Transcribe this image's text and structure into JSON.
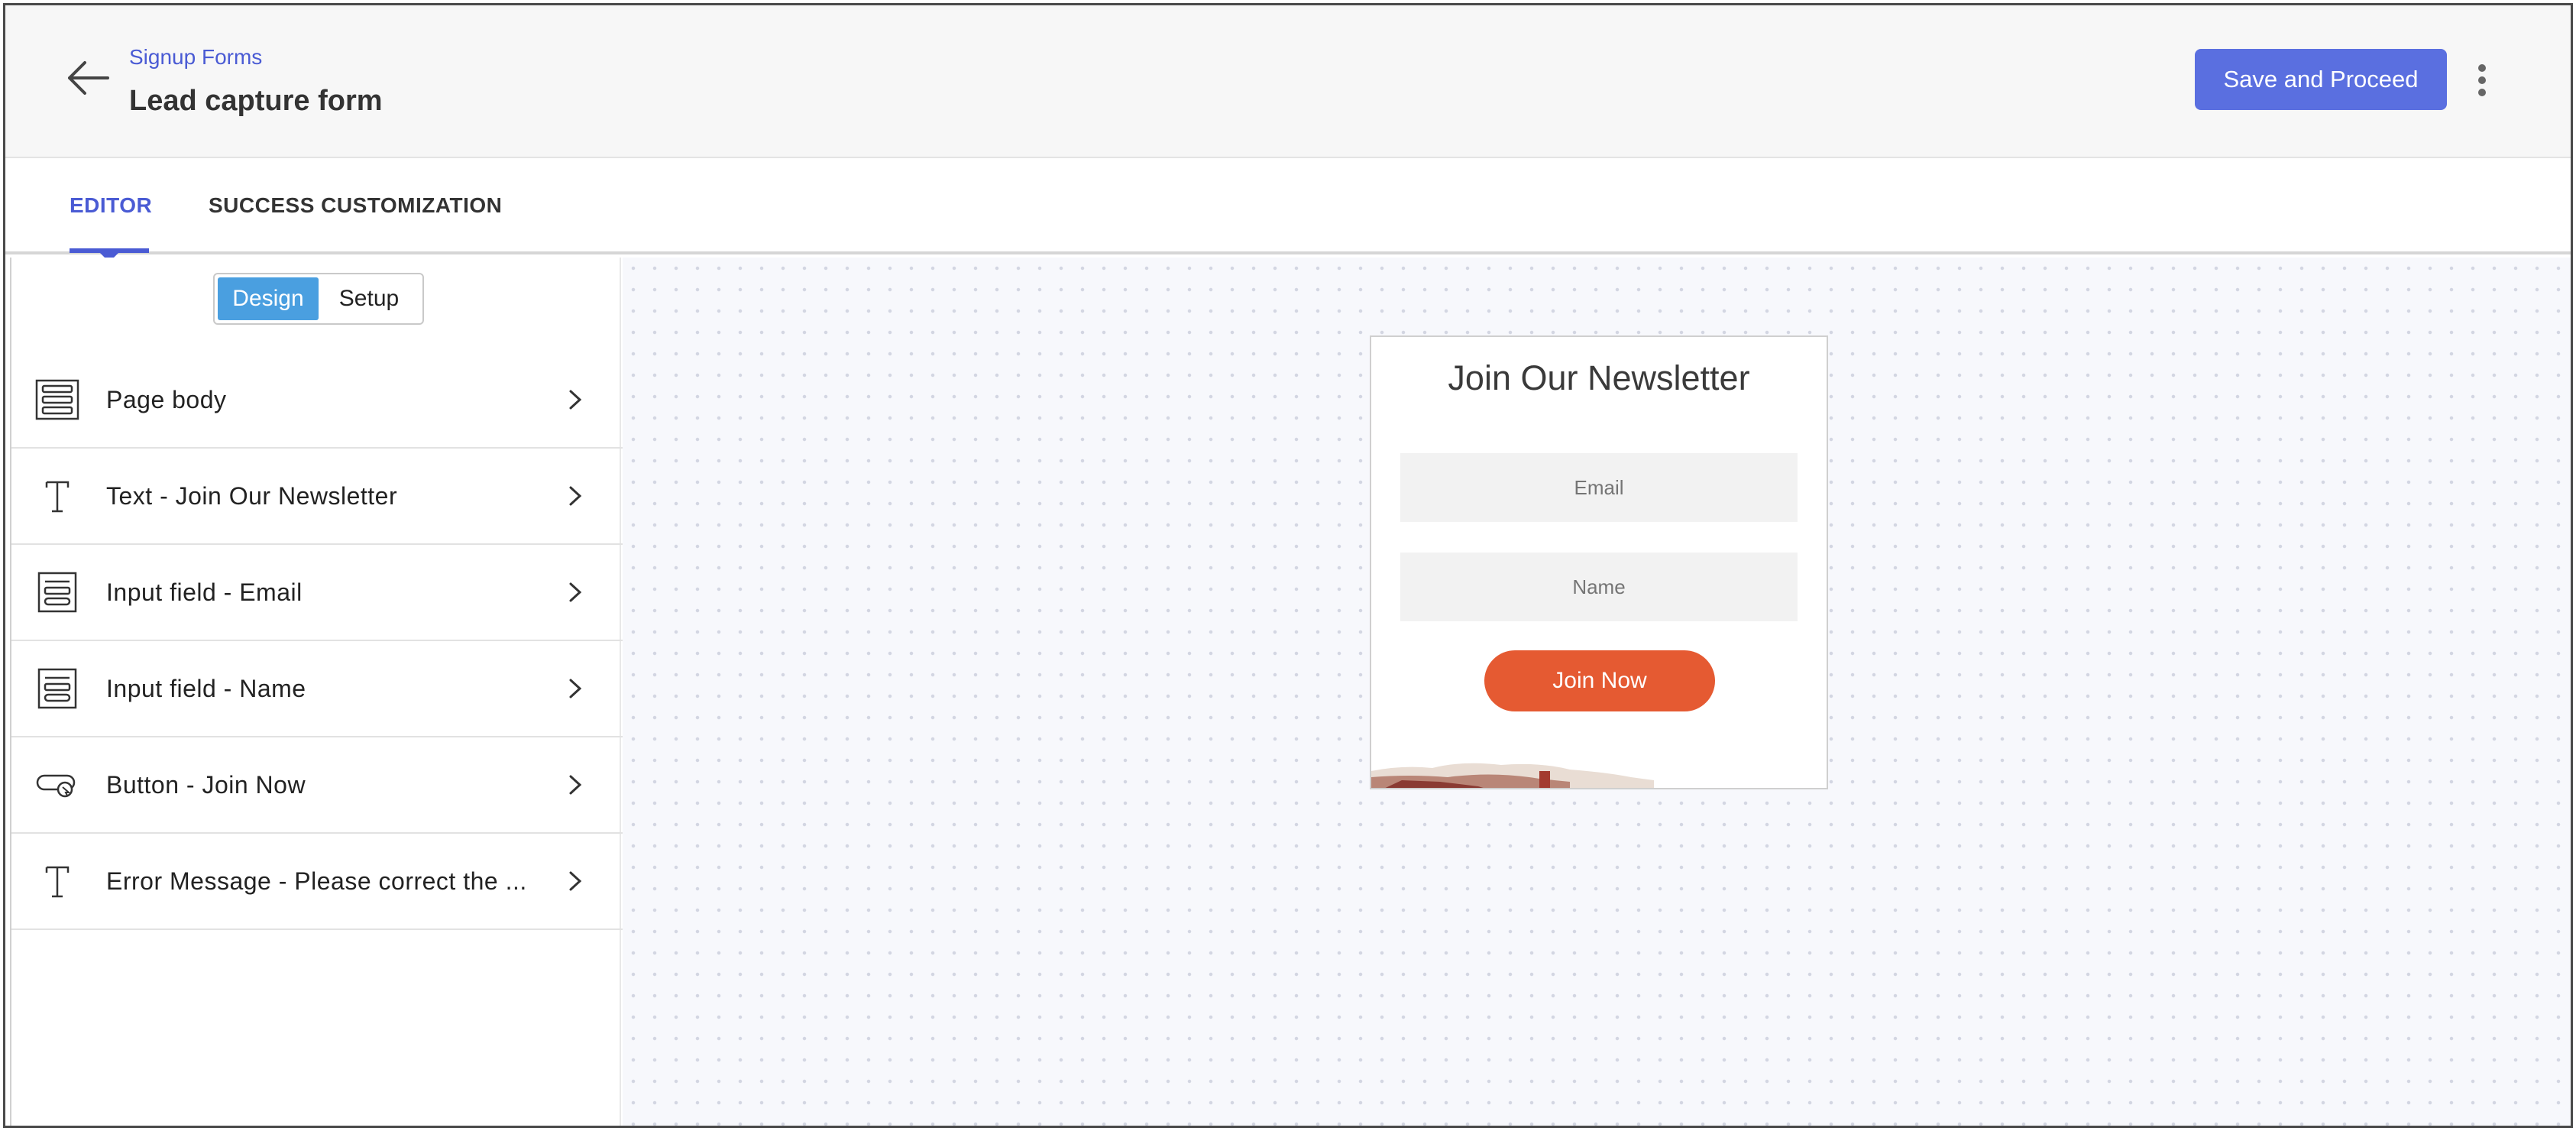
{
  "header": {
    "breadcrumb": "Signup Forms",
    "title": "Lead capture form",
    "save_label": "Save and Proceed",
    "accent_color": "#5a6fe0"
  },
  "tabs": [
    {
      "label": "EDITOR",
      "active": true
    },
    {
      "label": "SUCCESS CUSTOMIZATION",
      "active": false
    }
  ],
  "panel": {
    "toggle": {
      "design": "Design",
      "setup": "Setup",
      "selected": "Design"
    },
    "items": [
      {
        "label": "Page body",
        "icon": "layout-rows-icon"
      },
      {
        "label": "Text - Join Our Newsletter",
        "icon": "text-icon"
      },
      {
        "label": "Input field - Email",
        "icon": "input-field-icon"
      },
      {
        "label": "Input field - Name",
        "icon": "input-field-icon"
      },
      {
        "label": "Button - Join Now",
        "icon": "button-cursor-icon"
      },
      {
        "label": "Error Message - Please correct the ...",
        "icon": "text-icon"
      }
    ]
  },
  "preview": {
    "title": "Join Our Newsletter",
    "email_placeholder": "Email",
    "name_placeholder": "Name",
    "button_label": "Join Now",
    "button_color": "#e55a32"
  }
}
